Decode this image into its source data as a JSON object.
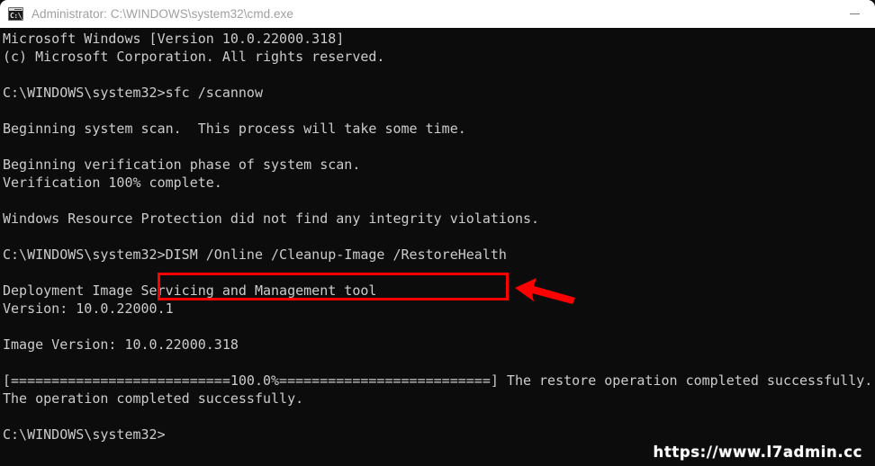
{
  "window": {
    "title": "Administrator: C:\\WINDOWS\\system32\\cmd.exe",
    "icon_name": "cmd-console-icon",
    "icon_glyph": "C:\\_",
    "minimize_label": "—",
    "background_color": "#0c0c0c",
    "titlebar_color": "#ffffff",
    "text_color": "#cccccc"
  },
  "console": {
    "lines": [
      "Microsoft Windows [Version 10.0.22000.318]",
      "(c) Microsoft Corporation. All rights reserved.",
      "",
      "C:\\WINDOWS\\system32>sfc /scannow",
      "",
      "Beginning system scan.  This process will take some time.",
      "",
      "Beginning verification phase of system scan.",
      "Verification 100% complete.",
      "",
      "Windows Resource Protection did not find any integrity violations.",
      "",
      "C:\\WINDOWS\\system32>DISM /Online /Cleanup-Image /RestoreHealth",
      "",
      "Deployment Image Servicing and Management tool",
      "Version: 10.0.22000.1",
      "",
      "Image Version: 10.0.22000.318",
      "",
      "[===========================100.0%==========================] The restore operation completed successfully.",
      "The operation completed successfully.",
      "",
      "C:\\WINDOWS\\system32>"
    ],
    "full_text": "Microsoft Windows [Version 10.0.22000.318]\n(c) Microsoft Corporation. All rights reserved.\n\nC:\\WINDOWS\\system32>sfc /scannow\n\nBeginning system scan.  This process will take some time.\n\nBeginning verification phase of system scan.\nVerification 100% complete.\n\nWindows Resource Protection did not find any integrity violations.\n\nC:\\WINDOWS\\system32>DISM /Online /Cleanup-Image /RestoreHealth\n\nDeployment Image Servicing and Management tool\nVersion: 10.0.22000.1\n\nImage Version: 10.0.22000.318\n\n[===========================100.0%==========================] The restore operation completed successfully.\nThe operation completed successfully.\n\nC:\\WINDOWS\\system32>",
    "commands": {
      "sfc": "sfc /scannow",
      "dism": "DISM /Online /Cleanup-Image /RestoreHealth"
    },
    "prompt": "C:\\WINDOWS\\system32>",
    "progress_percent": "100.0%"
  },
  "annotations": {
    "highlight_color": "#fe0000",
    "highlight_target": "DISM /Online /Cleanup-Image /RestoreHealth",
    "arrow_color": "#fe0000",
    "arrow_direction": "left"
  },
  "watermark": {
    "text": "https://www.l7admin.cc"
  }
}
